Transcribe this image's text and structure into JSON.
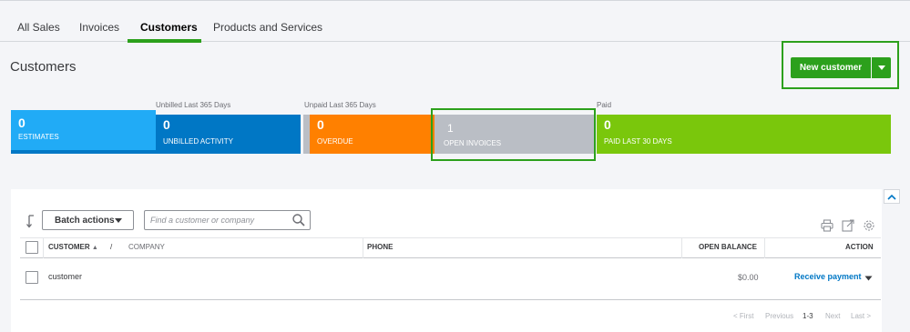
{
  "tabs": [
    {
      "label": "All Sales"
    },
    {
      "label": "Invoices"
    },
    {
      "label": "Customers"
    },
    {
      "label": "Products and Services"
    }
  ],
  "page_title": "Customers",
  "new_customer": {
    "label": "New customer",
    "dropdown_icon": "caret-down-icon"
  },
  "money_bar": {
    "unbilled_group": "Unbilled Last 365 Days",
    "unpaid_group": "Unpaid Last 365 Days",
    "paid_group": "Paid",
    "estimates": {
      "value": "0",
      "label": "ESTIMATES",
      "color": "#21abf6"
    },
    "unbilled": {
      "value": "0",
      "label": "UNBILLED ACTIVITY",
      "color": "#0077c5"
    },
    "overdue": {
      "value": "0",
      "label": "OVERDUE",
      "color": "#ff8000"
    },
    "open_invoices": {
      "value": "1",
      "label": "OPEN INVOICES",
      "color": "#babec5"
    },
    "paid": {
      "value": "0",
      "label": "PAID LAST 30 DAYS",
      "color": "#7ac70c"
    }
  },
  "toolbar": {
    "batch_actions": "Batch actions",
    "search_placeholder": "Find a customer or company"
  },
  "table": {
    "col_customer": "CUSTOMER",
    "sort_indicator": "▲",
    "slash": "/",
    "col_company": "COMPANY",
    "col_phone": "PHONE",
    "col_open_balance": "OPEN BALANCE",
    "col_action": "ACTION",
    "rows": [
      {
        "customer": "customer",
        "company": "",
        "phone": "",
        "open_balance": "$0.00",
        "action": "Receive payment"
      }
    ]
  },
  "pagination": {
    "first": "< First",
    "previous": "Previous",
    "range": "1-3",
    "next": "Next",
    "last": "Last >"
  },
  "colors": {
    "accent": "#2ca01c",
    "link": "#0077c5"
  }
}
